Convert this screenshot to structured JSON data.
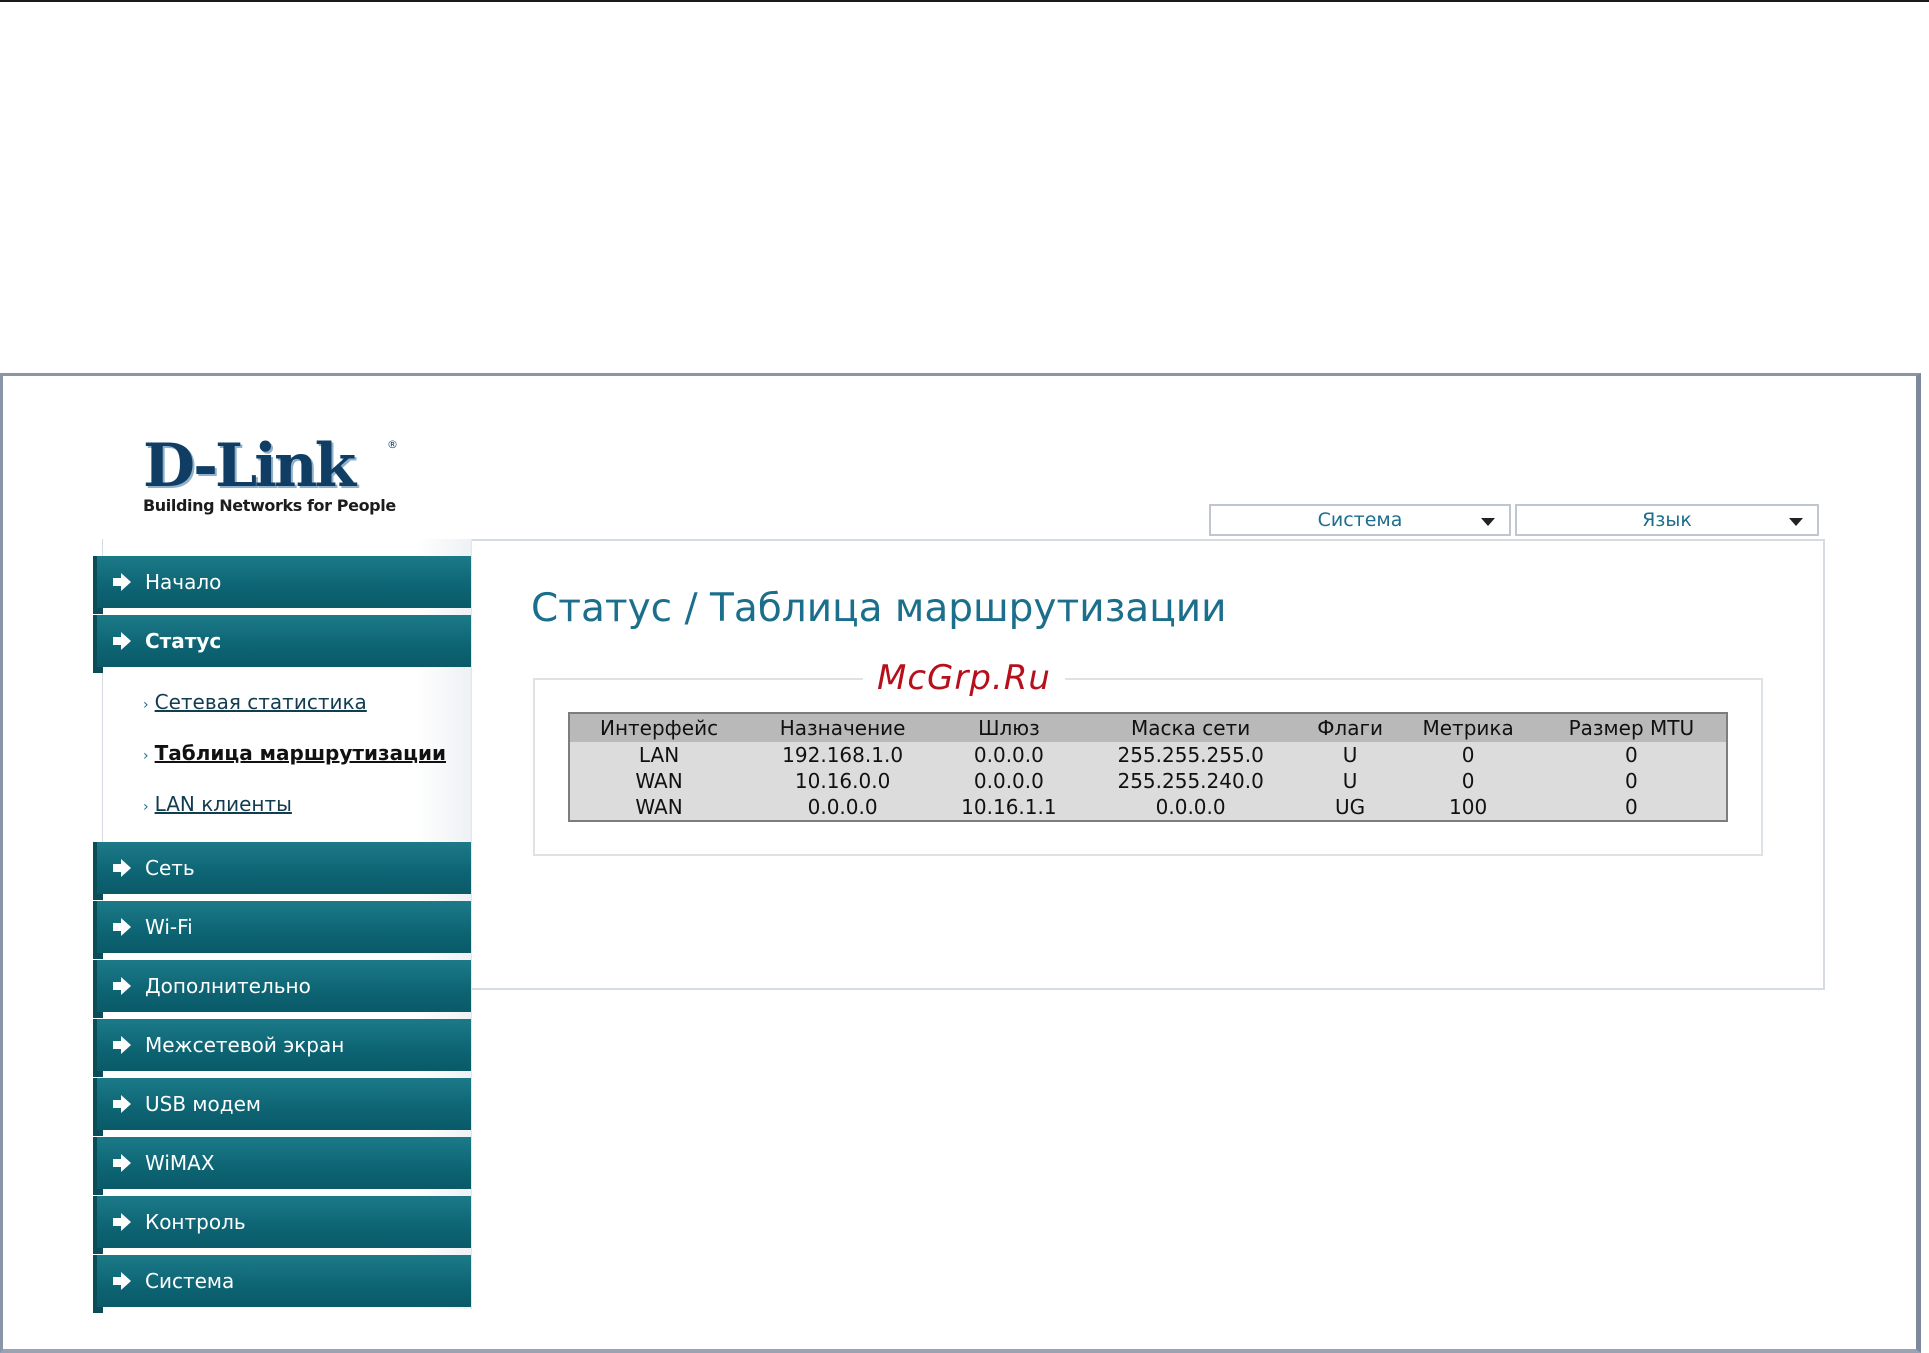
{
  "brand": {
    "name": "D-Link",
    "registered": "®",
    "tagline": "Building Networks for People"
  },
  "top_selectors": {
    "system": "Система",
    "language": "Язык"
  },
  "watermark": "McGrp.Ru",
  "sidebar": {
    "items": [
      {
        "label": "Начало"
      },
      {
        "label": "Статус"
      },
      {
        "label": "Сеть"
      },
      {
        "label": "Wi-Fi"
      },
      {
        "label": "Дополнительно"
      },
      {
        "label": "Межсетевой экран"
      },
      {
        "label": "USB модем"
      },
      {
        "label": "WiMAX"
      },
      {
        "label": "Контроль"
      },
      {
        "label": "Система"
      }
    ],
    "status_submenu": [
      {
        "label": "Сетевая статистика"
      },
      {
        "label": "Таблица маршрутизации"
      },
      {
        "label": "LAN клиенты"
      }
    ]
  },
  "page": {
    "title": "Статус  / Таблица маршрутизации"
  },
  "routing_table": {
    "columns": [
      "Интерфейс",
      "Назначение",
      "Шлюз",
      "Маска сети",
      "Флаги",
      "Метрика",
      "Размер MTU"
    ],
    "rows": [
      [
        "LAN",
        "192.168.1.0",
        "0.0.0.0",
        "255.255.255.0",
        "U",
        "0",
        "0"
      ],
      [
        "WAN",
        "10.16.0.0",
        "0.0.0.0",
        "255.255.240.0",
        "U",
        "0",
        "0"
      ],
      [
        "WAN",
        "0.0.0.0",
        "10.16.1.1",
        "0.0.0.0",
        "UG",
        "100",
        "0"
      ]
    ]
  }
}
